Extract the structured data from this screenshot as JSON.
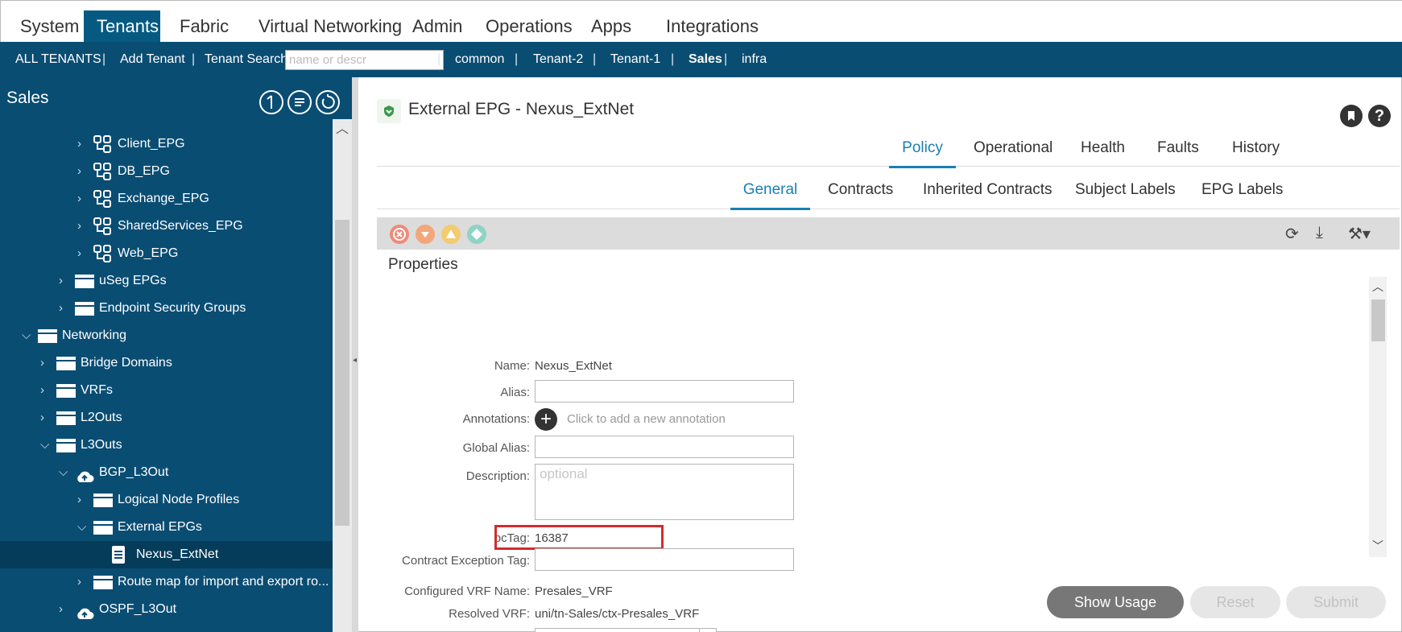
{
  "topnav": {
    "tabs": [
      {
        "label": "System"
      },
      {
        "label": "Tenants"
      },
      {
        "label": "Fabric"
      },
      {
        "label": "Virtual Networking"
      },
      {
        "label": "Admin"
      },
      {
        "label": "Operations"
      },
      {
        "label": "Apps"
      },
      {
        "label": "Integrations"
      }
    ],
    "active_tab": "Tenants"
  },
  "tenantbar": {
    "all_tenants": "ALL TENANTS",
    "add_tenant": "Add Tenant",
    "search_label": "Tenant Search:",
    "search_placeholder": "name or descr",
    "tenants": [
      "common",
      "Tenant-2",
      "Tenant-1",
      "Sales",
      "infra"
    ],
    "selected_tenant": "Sales"
  },
  "sidebar": {
    "title": "Sales",
    "tree": [
      {
        "label": "Client_EPG",
        "icon": "epg-icon",
        "expanded": false
      },
      {
        "label": "DB_EPG",
        "icon": "epg-icon",
        "expanded": false
      },
      {
        "label": "Exchange_EPG",
        "icon": "epg-icon",
        "expanded": false
      },
      {
        "label": "SharedServices_EPG",
        "icon": "epg-icon",
        "expanded": false
      },
      {
        "label": "Web_EPG",
        "icon": "epg-icon",
        "expanded": false
      },
      {
        "label": "uSeg EPGs",
        "icon": "folder-icon",
        "expanded": false
      },
      {
        "label": "Endpoint Security Groups",
        "icon": "folder-icon",
        "expanded": false
      },
      {
        "label": "Networking",
        "icon": "folder-icon",
        "expanded": true
      },
      {
        "label": "Bridge Domains",
        "icon": "folder-icon",
        "expanded": false
      },
      {
        "label": "VRFs",
        "icon": "folder-icon",
        "expanded": false
      },
      {
        "label": "L2Outs",
        "icon": "folder-icon",
        "expanded": false
      },
      {
        "label": "L3Outs",
        "icon": "folder-icon",
        "expanded": true
      },
      {
        "label": "BGP_L3Out",
        "icon": "cloud-icon",
        "expanded": true
      },
      {
        "label": "Logical Node Profiles",
        "icon": "folder-icon",
        "expanded": false
      },
      {
        "label": "External EPGs",
        "icon": "folder-icon",
        "expanded": true
      },
      {
        "label": "Nexus_ExtNet",
        "icon": "document-icon",
        "selected": true
      },
      {
        "label": "Route map for import and export ro...",
        "icon": "folder-icon",
        "expanded": false
      },
      {
        "label": "OSPF_L3Out",
        "icon": "cloud-icon",
        "expanded": false
      }
    ]
  },
  "main": {
    "title": "External EPG - Nexus_ExtNet",
    "tabs": [
      "Policy",
      "Operational",
      "Health",
      "Faults",
      "History"
    ],
    "active_tab": "Policy",
    "subtabs": [
      "General",
      "Contracts",
      "Inherited Contracts",
      "Subject Labels",
      "EPG Labels"
    ],
    "active_subtab": "General",
    "fault_icons": [
      {
        "name": "critical-fault-icon",
        "color": "#f08a7a"
      },
      {
        "name": "major-fault-icon",
        "color": "#f2a77a"
      },
      {
        "name": "minor-fault-icon",
        "color": "#f3cb70"
      },
      {
        "name": "warning-fault-icon",
        "color": "#8fd3c6"
      }
    ],
    "properties_title": "Properties",
    "fields": {
      "name": {
        "label": "Name:",
        "value": "Nexus_ExtNet"
      },
      "alias": {
        "label": "Alias:",
        "value": ""
      },
      "annotations": {
        "label": "Annotations:",
        "hint": "Click to add a new annotation"
      },
      "global_alias": {
        "label": "Global Alias:",
        "value": ""
      },
      "description": {
        "label": "Description:",
        "placeholder": "optional"
      },
      "pctag": {
        "label": "pcTag:",
        "value": "16387"
      },
      "contract_exception_tag": {
        "label": "Contract Exception Tag:",
        "value": ""
      },
      "configured_vrf": {
        "label": "Configured VRF Name:",
        "value": "Presales_VRF"
      },
      "resolved_vrf": {
        "label": "Resolved VRF:",
        "value": "uni/tn-Sales/ctx-Presales_VRF"
      }
    },
    "buttons": {
      "show_usage": "Show Usage",
      "reset": "Reset",
      "submit": "Submit"
    }
  }
}
